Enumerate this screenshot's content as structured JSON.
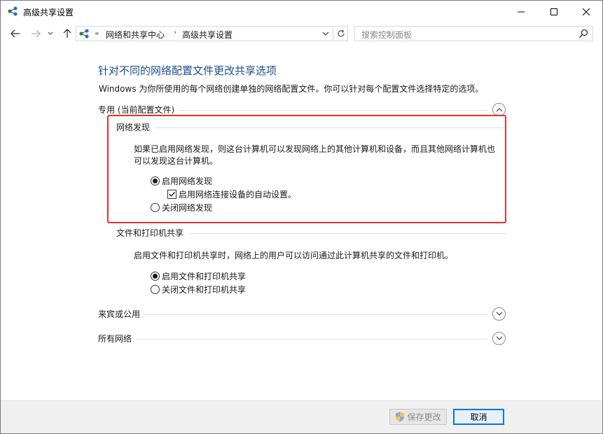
{
  "window": {
    "title": "高级共享设置"
  },
  "address": {
    "separator": "«",
    "crumbs": [
      "网络和共享中心",
      "高级共享设置"
    ],
    "arrow": "›"
  },
  "search": {
    "placeholder": "搜索控制面板"
  },
  "main": {
    "heading": "针对不同的网络配置文件更改共享选项",
    "description": "Windows 为你所使用的每个网络创建单独的网络配置文件。你可以针对每个配置文件选择特定的选项。",
    "private": {
      "label": "专用 (当前配置文件)",
      "expanded": true,
      "network_discovery": {
        "label": "网络发现",
        "text_line1": "如果已启用网络发现，则这台计算机可以发现网络上的其他计算机和设备，而且其他网络计算机也",
        "text_line2": "可以发现这台计算机。",
        "option_on": "启用网络发现",
        "option_on_selected": true,
        "auto_setup": "启用网络连接设备的自动设置。",
        "auto_setup_checked": true,
        "option_off": "关闭网络发现"
      },
      "file_printer": {
        "label": "文件和打印机共享",
        "text": "启用文件和打印机共享时，网络上的用户可以访问通过此计算机共享的文件和打印机。",
        "option_on": "启用文件和打印机共享",
        "option_on_selected": true,
        "option_off": "关闭文件和打印机共享"
      }
    },
    "guest": {
      "label": "来宾或公用",
      "expanded": false
    },
    "all": {
      "label": "所有网络",
      "expanded": false
    }
  },
  "footer": {
    "save_label": "保存更改",
    "save_enabled": false,
    "cancel_label": "取消"
  },
  "colors": {
    "heading": "#1e4e8c",
    "highlight": "#e8312a",
    "focus": "#0078d7"
  }
}
